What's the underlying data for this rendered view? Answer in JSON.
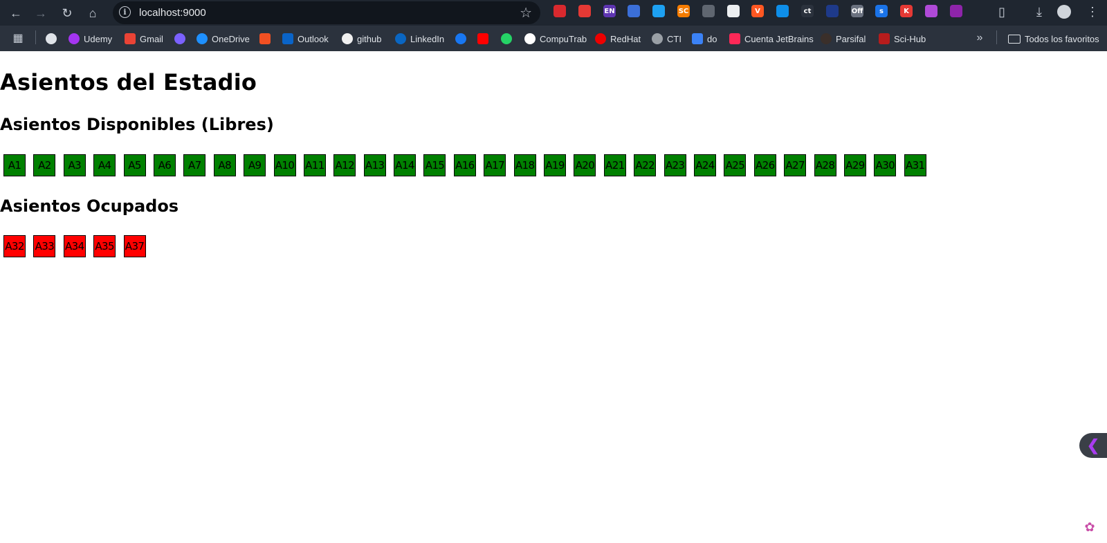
{
  "browser": {
    "url": "localhost:9000",
    "extensions": [
      {
        "icon": "mendeley-icon",
        "text": "",
        "color": "#d9292e"
      },
      {
        "icon": "hand-stop-icon",
        "text": "",
        "color": "#e53935"
      },
      {
        "icon": "translate-icon",
        "text": "EN",
        "color": "#5e35b1"
      },
      {
        "icon": "shield-icon",
        "text": "",
        "color": "#3b6fd8"
      },
      {
        "icon": "bird-icon",
        "text": "",
        "color": "#1da1f2"
      },
      {
        "icon": "sc-icon",
        "text": "SC",
        "color": "#f57c00"
      },
      {
        "icon": "document-icon",
        "text": "",
        "color": "#5f6670"
      },
      {
        "icon": "ghost-icon",
        "text": "",
        "color": "#eceff1"
      },
      {
        "icon": "v-icon",
        "text": "V",
        "color": "#ff5722"
      },
      {
        "icon": "edge-icon",
        "text": "",
        "color": "#0e8ee9"
      },
      {
        "icon": "ct-icon",
        "text": "ct",
        "color": "#2b323d"
      },
      {
        "icon": "delta-icon",
        "text": "",
        "color": "#1e3a8a"
      },
      {
        "icon": "off-icon",
        "text": "Off",
        "color": "#6b7280"
      },
      {
        "icon": "s-icon",
        "text": "s",
        "color": "#1a73e8"
      },
      {
        "icon": "k-icon",
        "text": "K",
        "color": "#e53935"
      },
      {
        "icon": "brain-icon",
        "text": "",
        "color": "#b04ad8"
      },
      {
        "icon": "claude-icon",
        "text": "",
        "color": "#8e24aa"
      }
    ]
  },
  "bookmarks": {
    "items": [
      {
        "label": "",
        "icon": "vivaldi-icon",
        "color": "#dfe3e8"
      },
      {
        "label": "Udemy",
        "icon": "udemy-icon",
        "color": "#a435f0"
      },
      {
        "label": "Gmail",
        "icon": "gmail-icon",
        "color": "#ea4335"
      },
      {
        "label": "",
        "icon": "copilot-icon",
        "color": "#7b61ff"
      },
      {
        "label": "OneDrive",
        "icon": "onedrive-icon",
        "color": "#1e90ff"
      },
      {
        "label": "",
        "icon": "microsoft-icon",
        "color": "#f25022"
      },
      {
        "label": "Outlook",
        "icon": "outlook-icon",
        "color": "#0a64c8"
      },
      {
        "label": "github",
        "icon": "github-icon",
        "color": "#f0f0f0"
      },
      {
        "label": "LinkedIn",
        "icon": "linkedin-icon",
        "color": "#0a66c2"
      },
      {
        "label": "",
        "icon": "facebook-icon",
        "color": "#1877f2"
      },
      {
        "label": "",
        "icon": "youtube-icon",
        "color": "#ff0000"
      },
      {
        "label": "",
        "icon": "whatsapp-icon",
        "color": "#25d366"
      },
      {
        "label": "CompuTrab",
        "icon": "computrab-icon",
        "color": "#ffffff"
      },
      {
        "label": "RedHat",
        "icon": "redhat-icon",
        "color": "#ee0000"
      },
      {
        "label": "CTI",
        "icon": "globe-icon",
        "color": "#9aa0a6"
      },
      {
        "label": "do",
        "icon": "sd-icon",
        "color": "#3b82f6"
      },
      {
        "label": "Cuenta JetBrains",
        "icon": "jetbrains-icon",
        "color": "#fe2857"
      },
      {
        "label": "Parsifal",
        "icon": "trophy-icon",
        "color": "#3a2f2a"
      },
      {
        "label": "Sci-Hub",
        "icon": "scihub-icon",
        "color": "#b71c1c"
      }
    ],
    "all_favorites": "Todos los favoritos"
  },
  "page": {
    "title": "Asientos del Estadio",
    "available_heading": "Asientos Disponibles (Libres)",
    "occupied_heading": "Asientos Ocupados"
  },
  "seats": {
    "free_color": "#008000",
    "taken_color": "#ff0000",
    "available": [
      "A1",
      "A2",
      "A3",
      "A4",
      "A5",
      "A6",
      "A7",
      "A8",
      "A9",
      "A10",
      "A11",
      "A12",
      "A13",
      "A14",
      "A15",
      "A16",
      "A17",
      "A18",
      "A19",
      "A20",
      "A21",
      "A22",
      "A23",
      "A24",
      "A25",
      "A26",
      "A27",
      "A28",
      "A29",
      "A30",
      "A31"
    ],
    "occupied": [
      "A32",
      "A33",
      "A34",
      "A35",
      "A37"
    ]
  }
}
